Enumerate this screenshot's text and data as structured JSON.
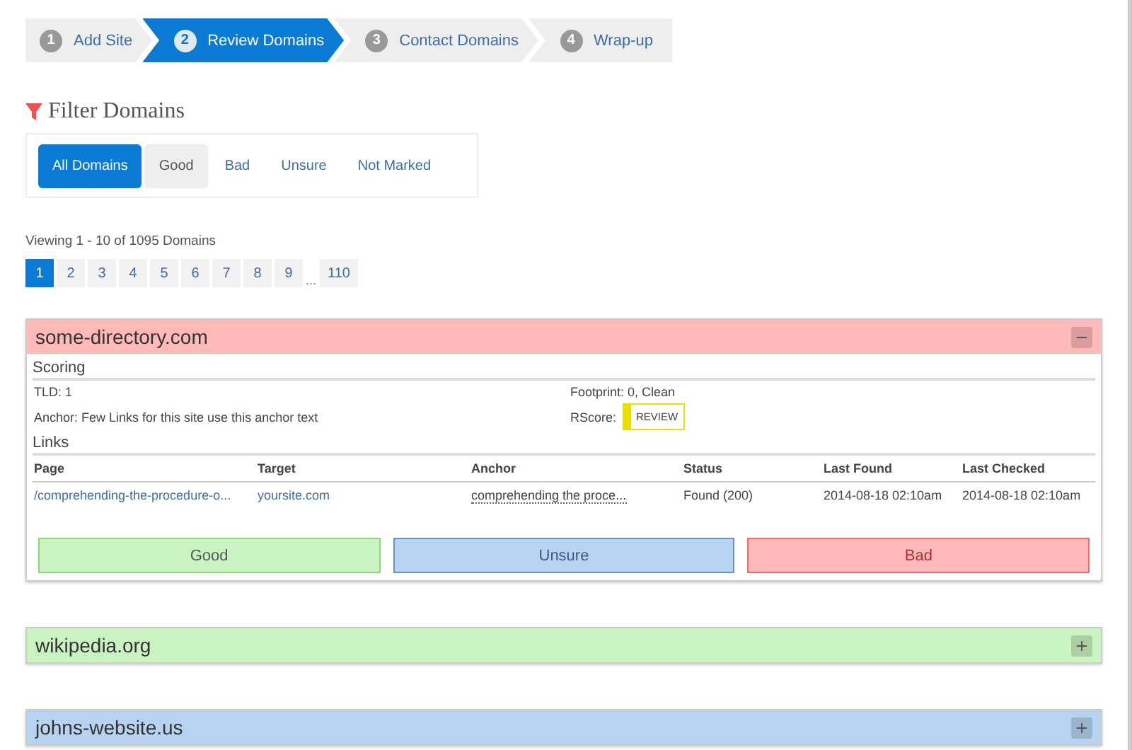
{
  "steps": [
    {
      "number": "1",
      "label": "Add Site",
      "selected": false
    },
    {
      "number": "2",
      "label": "Review Domains",
      "selected": true
    },
    {
      "number": "3",
      "label": "Contact Domains",
      "selected": false
    },
    {
      "number": "4",
      "label": "Wrap-up",
      "selected": false
    }
  ],
  "filter": {
    "title": "Filter Domains",
    "options": [
      {
        "label": "All Domains",
        "selected": true,
        "hover": false
      },
      {
        "label": "Good",
        "selected": false,
        "hover": true
      },
      {
        "label": "Bad",
        "selected": false,
        "hover": false
      },
      {
        "label": "Unsure",
        "selected": false,
        "hover": false
      },
      {
        "label": "Not Marked",
        "selected": false,
        "hover": false
      }
    ]
  },
  "viewing": "Viewing 1 - 10 of 1095 Domains",
  "pagination": [
    {
      "label": "1",
      "selected": true
    },
    {
      "label": "2",
      "selected": false
    },
    {
      "label": "3",
      "selected": false
    },
    {
      "label": "4",
      "selected": false
    },
    {
      "label": "5",
      "selected": false
    },
    {
      "label": "6",
      "selected": false
    },
    {
      "label": "7",
      "selected": false
    },
    {
      "label": "8",
      "selected": false
    },
    {
      "label": "9",
      "selected": false
    },
    {
      "label": "...",
      "kind": "gap"
    },
    {
      "label": "110",
      "selected": false
    }
  ],
  "domains": [
    {
      "name": "some-directory.com",
      "color": "#ffb9b9",
      "expanded": true,
      "scoring": {
        "title": "Scoring",
        "tld": "TLD: 1",
        "anchor": "Anchor: Few Links for this site use this anchor text",
        "footprint": "Footprint: 0, Clean",
        "rscore_label": "RScore:",
        "rscore": "REVIEW"
      },
      "links": {
        "title": "Links",
        "columns": [
          "Page",
          "Target",
          "Anchor",
          "Status",
          "Last Found",
          "Last Checked"
        ],
        "rows": [
          [
            "/comprehending-the-procedure-o...",
            "yoursite.com",
            "comprehending the proce...",
            "Found (200)",
            "2014-08-18 02:10am",
            "2014-08-18 02:10am"
          ]
        ]
      },
      "actions": [
        {
          "label": "Good",
          "kind": "good"
        },
        {
          "label": "Unsure",
          "kind": "unsure"
        },
        {
          "label": "Bad",
          "kind": "bad"
        }
      ]
    },
    {
      "name": "wikipedia.org",
      "color": "#c9f3c0",
      "expanded": false
    },
    {
      "name": "johns-website.us",
      "color": "#b8d3f0",
      "expanded": false
    }
  ]
}
